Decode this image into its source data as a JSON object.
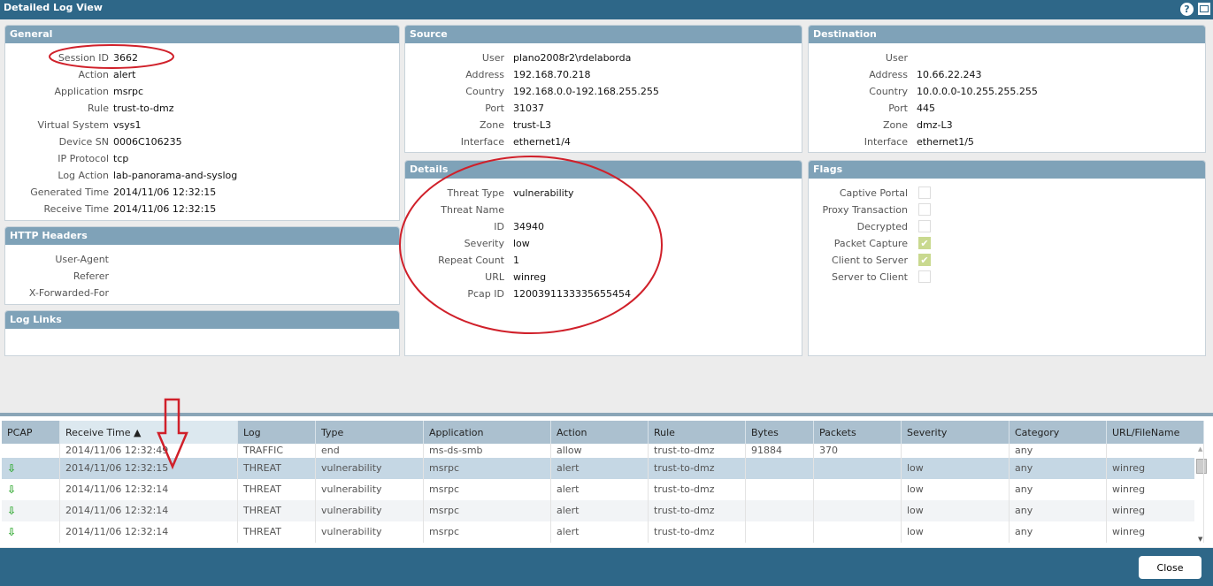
{
  "window": {
    "title": "Detailed Log View",
    "help_icon": "help-icon",
    "maximize_icon": "maximize-icon"
  },
  "general": {
    "title": "General",
    "fields": [
      [
        "Session ID",
        "3662"
      ],
      [
        "Action",
        "alert"
      ],
      [
        "Application",
        "msrpc"
      ],
      [
        "Rule",
        "trust-to-dmz"
      ],
      [
        "Virtual System",
        "vsys1"
      ],
      [
        "Device SN",
        "0006C106235"
      ],
      [
        "IP Protocol",
        "tcp"
      ],
      [
        "Log Action",
        "lab-panorama-and-syslog"
      ],
      [
        "Generated Time",
        "2014/11/06 12:32:15"
      ],
      [
        "Receive Time",
        "2014/11/06 12:32:15"
      ]
    ]
  },
  "http": {
    "title": "HTTP Headers",
    "fields": [
      [
        "User-Agent",
        ""
      ],
      [
        "Referer",
        ""
      ],
      [
        "X-Forwarded-For",
        ""
      ]
    ]
  },
  "links": {
    "title": "Log Links"
  },
  "source": {
    "title": "Source",
    "fields": [
      [
        "User",
        "plano2008r2\\rdelaborda"
      ],
      [
        "Address",
        "192.168.70.218"
      ],
      [
        "Country",
        "192.168.0.0-192.168.255.255"
      ],
      [
        "Port",
        "31037"
      ],
      [
        "Zone",
        "trust-L3"
      ],
      [
        "Interface",
        "ethernet1/4"
      ]
    ]
  },
  "destination": {
    "title": "Destination",
    "fields": [
      [
        "User",
        ""
      ],
      [
        "Address",
        "10.66.22.243"
      ],
      [
        "Country",
        "10.0.0.0-10.255.255.255"
      ],
      [
        "Port",
        "445"
      ],
      [
        "Zone",
        "dmz-L3"
      ],
      [
        "Interface",
        "ethernet1/5"
      ]
    ]
  },
  "details": {
    "title": "Details",
    "fields": [
      [
        "Threat Type",
        "vulnerability"
      ],
      [
        "Threat Name",
        ""
      ],
      [
        "ID",
        "34940"
      ],
      [
        "Severity",
        "low"
      ],
      [
        "Repeat Count",
        "1"
      ],
      [
        "URL",
        "winreg"
      ],
      [
        "Pcap ID",
        "1200391133335655454"
      ]
    ]
  },
  "flags": {
    "title": "Flags",
    "items": [
      [
        "Captive Portal",
        false
      ],
      [
        "Proxy Transaction",
        false
      ],
      [
        "Decrypted",
        false
      ],
      [
        "Packet Capture",
        true
      ],
      [
        "Client to Server",
        true
      ],
      [
        "Server to Client",
        false
      ]
    ]
  },
  "grid": {
    "columns": [
      "PCAP",
      "Receive Time ▲",
      "Log",
      "Type",
      "Application",
      "Action",
      "Rule",
      "Bytes",
      "Packets",
      "Severity",
      "Category",
      "URL/FileName"
    ],
    "sorted_column": "Receive Time",
    "sort": "ascending",
    "rows": [
      [
        "",
        "2014/11/06 12:32:49",
        "TRAFFIC",
        "end",
        "ms-ds-smb",
        "allow",
        "trust-to-dmz",
        "91884",
        "370",
        "",
        "any",
        ""
      ],
      [
        "pcap",
        "2014/11/06 12:32:15",
        "THREAT",
        "vulnerability",
        "msrpc",
        "alert",
        "trust-to-dmz",
        "",
        "",
        "low",
        "any",
        "winreg"
      ],
      [
        "pcap",
        "2014/11/06 12:32:14",
        "THREAT",
        "vulnerability",
        "msrpc",
        "alert",
        "trust-to-dmz",
        "",
        "",
        "low",
        "any",
        "winreg"
      ],
      [
        "pcap",
        "2014/11/06 12:32:14",
        "THREAT",
        "vulnerability",
        "msrpc",
        "alert",
        "trust-to-dmz",
        "",
        "",
        "low",
        "any",
        "winreg"
      ],
      [
        "pcap",
        "2014/11/06 12:32:14",
        "THREAT",
        "vulnerability",
        "msrpc",
        "alert",
        "trust-to-dmz",
        "",
        "",
        "low",
        "any",
        "winreg"
      ]
    ],
    "selected_row": 1
  },
  "footer": {
    "close_label": "Close"
  },
  "colors": {
    "titlebar": "#2e6788",
    "panel_header": "#7fa2b8",
    "annotation": "#d0202a",
    "check": "#c9d98f"
  }
}
